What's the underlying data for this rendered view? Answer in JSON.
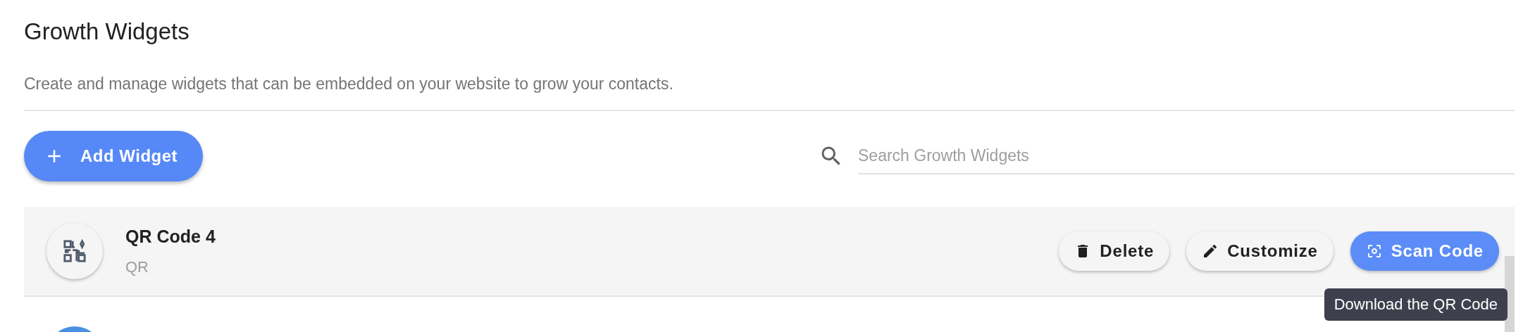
{
  "title": "Growth Widgets",
  "description": "Create and manage widgets that can be embedded on your website to grow your contacts.",
  "add_button": {
    "label": "Add Widget"
  },
  "search": {
    "placeholder": "Search Growth Widgets"
  },
  "widgets": [
    {
      "name": "QR Code 4",
      "type": "QR",
      "actions": [
        {
          "kind": "delete",
          "label": "Delete"
        },
        {
          "kind": "customize",
          "label": "Customize"
        },
        {
          "kind": "scan",
          "label": "Scan Code"
        }
      ]
    }
  ],
  "tooltip": "Download the QR Code"
}
